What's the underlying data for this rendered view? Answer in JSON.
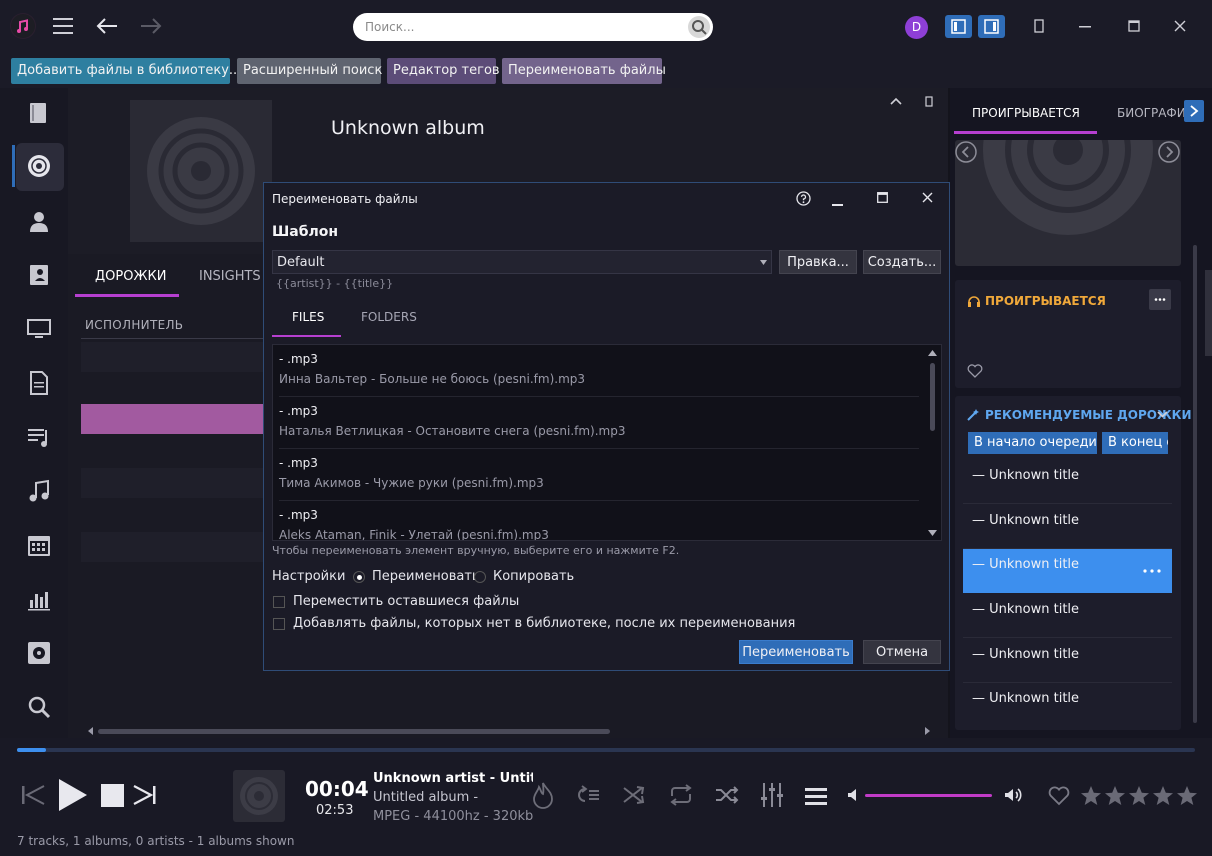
{
  "titlebar": {
    "search_placeholder": "Поиск...",
    "avatar_letter": "D"
  },
  "toolbar": {
    "add_files": "Добавить файлы в библиотеку...",
    "advanced_search": "Расширенный поиск",
    "tag_editor": "Редактор тегов",
    "rename_files": "Переименовать файлы"
  },
  "album": {
    "title": "Unknown album",
    "tabs": [
      "ДОРОЖКИ",
      "INSIGHTS"
    ],
    "column_artist": "ИСПОЛНИТЕЛЬ"
  },
  "right": {
    "tab_playing": "ПРОИГРЫВАЕТСЯ",
    "tab_bio": "БИОГРАФИ",
    "now_playing_title": "ПРОИГРЫВАЕТСЯ",
    "recommended_title": "РЕКОМЕНДУЕМЫЕ ДОРОЖКИ",
    "queue_start": "В начало очереди",
    "queue_end": "В конец очереди",
    "tracks": [
      "— Unknown title",
      "— Unknown title",
      "— Unknown title",
      "— Unknown title",
      "— Unknown title",
      "— Unknown title"
    ]
  },
  "dialog": {
    "title": "Переименовать файлы",
    "section": "Шаблон",
    "template_value": "Default",
    "edit_btn": "Правка...",
    "create_btn": "Создать...",
    "template_hint": "{{artist}} - {{title}}",
    "tabs": [
      "FILES",
      "FOLDERS"
    ],
    "files": [
      {
        "new": "- .mp3",
        "old": "Инна Вальтер - Больше не боюсь (pesni.fm).mp3"
      },
      {
        "new": "- .mp3",
        "old": "Наталья Ветлицкая - Остановите снега (pesni.fm).mp3"
      },
      {
        "new": "- .mp3",
        "old": "Тима Акимов - Чужие руки (pesni.fm).mp3"
      },
      {
        "new": "- .mp3",
        "old": "Aleks Ataman, Finik - Улетай (pesni.fm).mp3"
      }
    ],
    "note": "Чтобы переименовать элемент вручную, выберите его и нажмите F2.",
    "settings_label": "Настройки",
    "radio_rename": "Переименовать",
    "radio_copy": "Копировать",
    "chk_move": "Переместить оставшиеся файлы",
    "chk_add": "Добавлять файлы, которых нет в библиотеке, после их переименования",
    "rename_btn": "Переименовать",
    "cancel_btn": "Отмена"
  },
  "player": {
    "elapsed": "00:04",
    "total": "02:53",
    "track": "Unknown artist - Untitled",
    "album": "Untitled album -",
    "format": "MPEG - 44100hz - 320kbps",
    "progress_fraction": 0.025
  },
  "status": "7 tracks, 1 albums, 0 artists - 1 albums shown",
  "colors": {
    "accent_blue": "#2f6db8",
    "accent_magenta": "#b63fd0",
    "orange": "#f0a83a"
  }
}
